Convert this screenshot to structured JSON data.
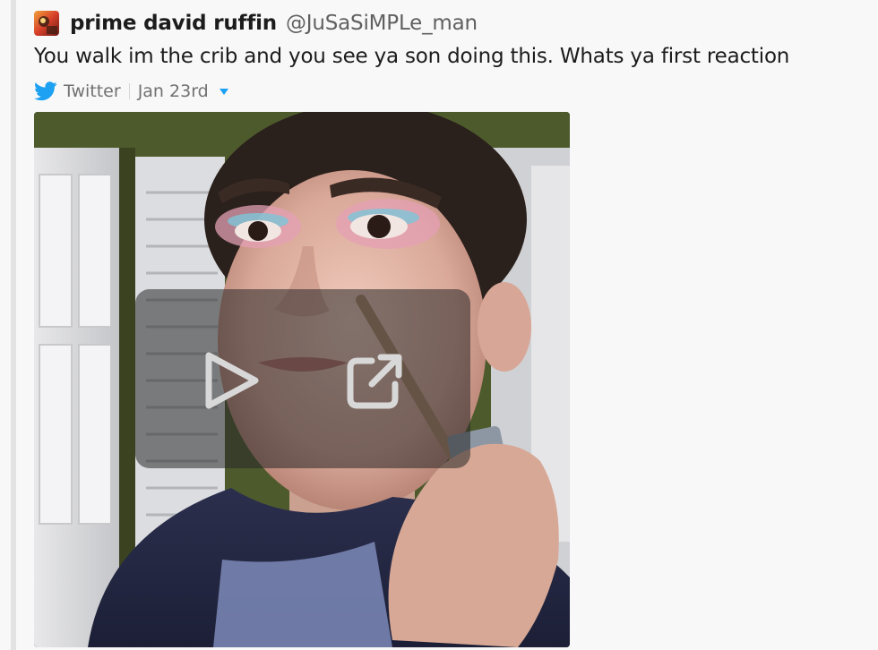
{
  "tweet": {
    "author_name": "prime david ruffin",
    "author_handle": "@JuSaSiMPLe_man",
    "text": "You walk im the crib and you see ya son doing this. Whats ya first reaction",
    "source": "Twitter",
    "date": "Jan 23rd"
  },
  "video": {
    "controls": [
      "play-icon",
      "external-link-icon"
    ]
  },
  "colors": {
    "twitter_blue": "#1da1f2",
    "text": "#1d1c1d",
    "muted": "#616061",
    "background": "#f8f8f8"
  }
}
